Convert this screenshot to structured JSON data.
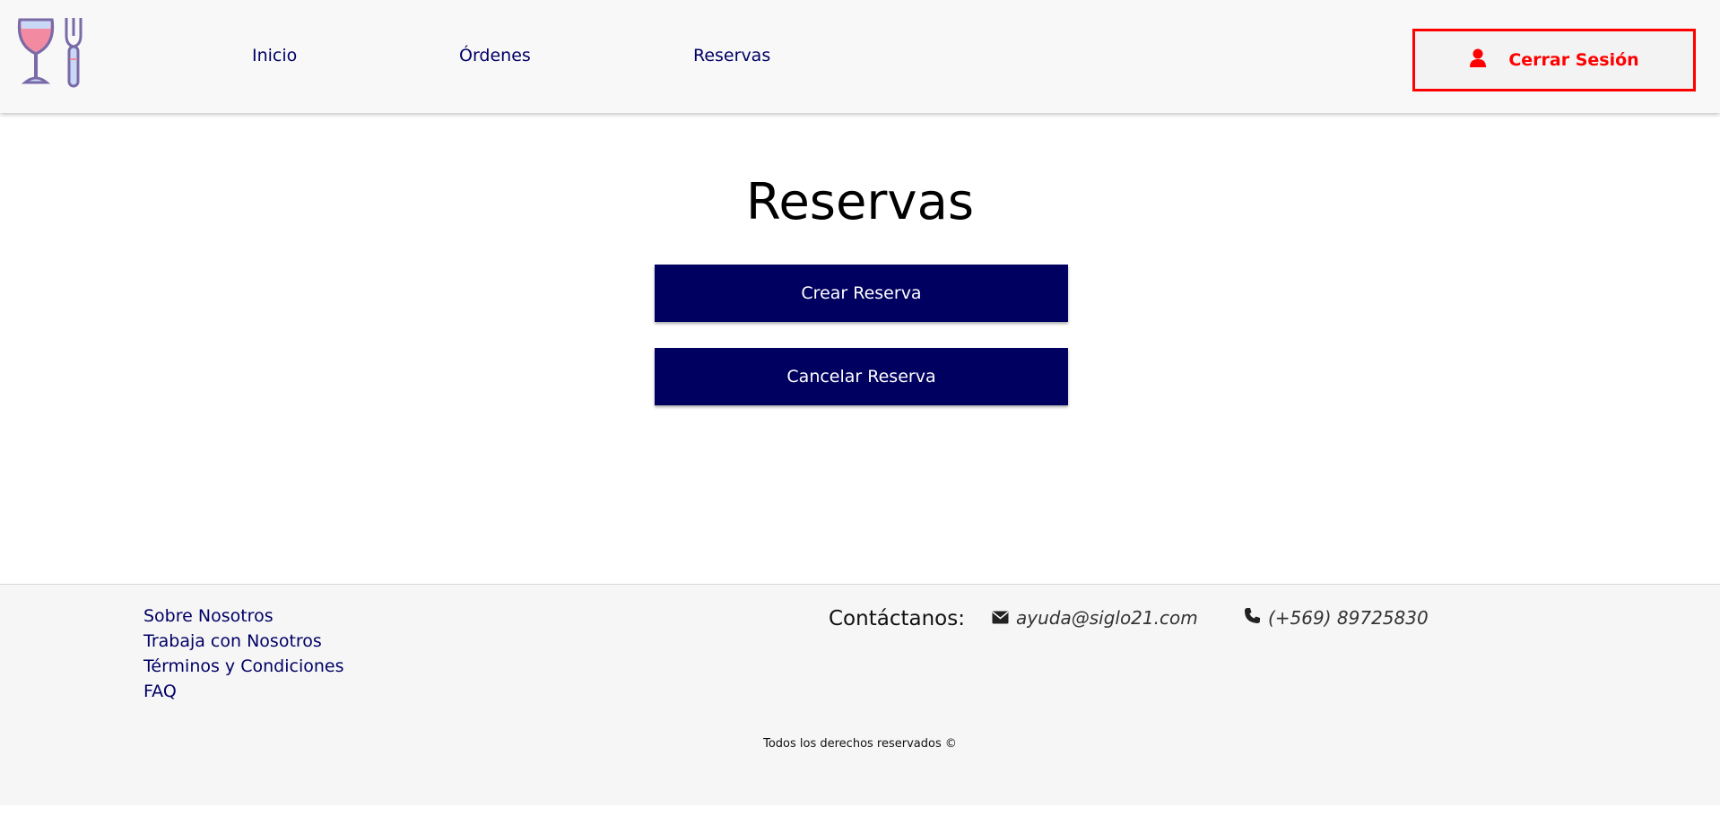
{
  "navbar": {
    "logo_icon": "wine-glass-fork-icon",
    "links": [
      {
        "label": "Inicio"
      },
      {
        "label": "Órdenes"
      },
      {
        "label": "Reservas"
      }
    ],
    "logout": {
      "label": "Cerrar Sesión",
      "icon": "user-icon",
      "color": "#ff0000"
    }
  },
  "main": {
    "title": "Reservas",
    "buttons": [
      {
        "label": "Crear Reserva"
      },
      {
        "label": "Cancelar Reserva"
      }
    ],
    "button_color": "#000060"
  },
  "footer": {
    "links": [
      {
        "label": "Sobre Nosotros"
      },
      {
        "label": "Trabaja con Nosotros"
      },
      {
        "label": "Términos y Condiciones"
      },
      {
        "label": "FAQ"
      }
    ],
    "contact_heading": "Contáctanos:",
    "email": {
      "icon": "envelope-icon",
      "value": "ayuda@siglo21.com"
    },
    "phone": {
      "icon": "phone-icon",
      "value": "(+569) 89725830"
    },
    "copyright": "Todos los derechos reservados ©"
  },
  "colors": {
    "nav_text": "#000066",
    "logout_border": "#ff0000",
    "footer_bg": "#f6f6f6"
  }
}
